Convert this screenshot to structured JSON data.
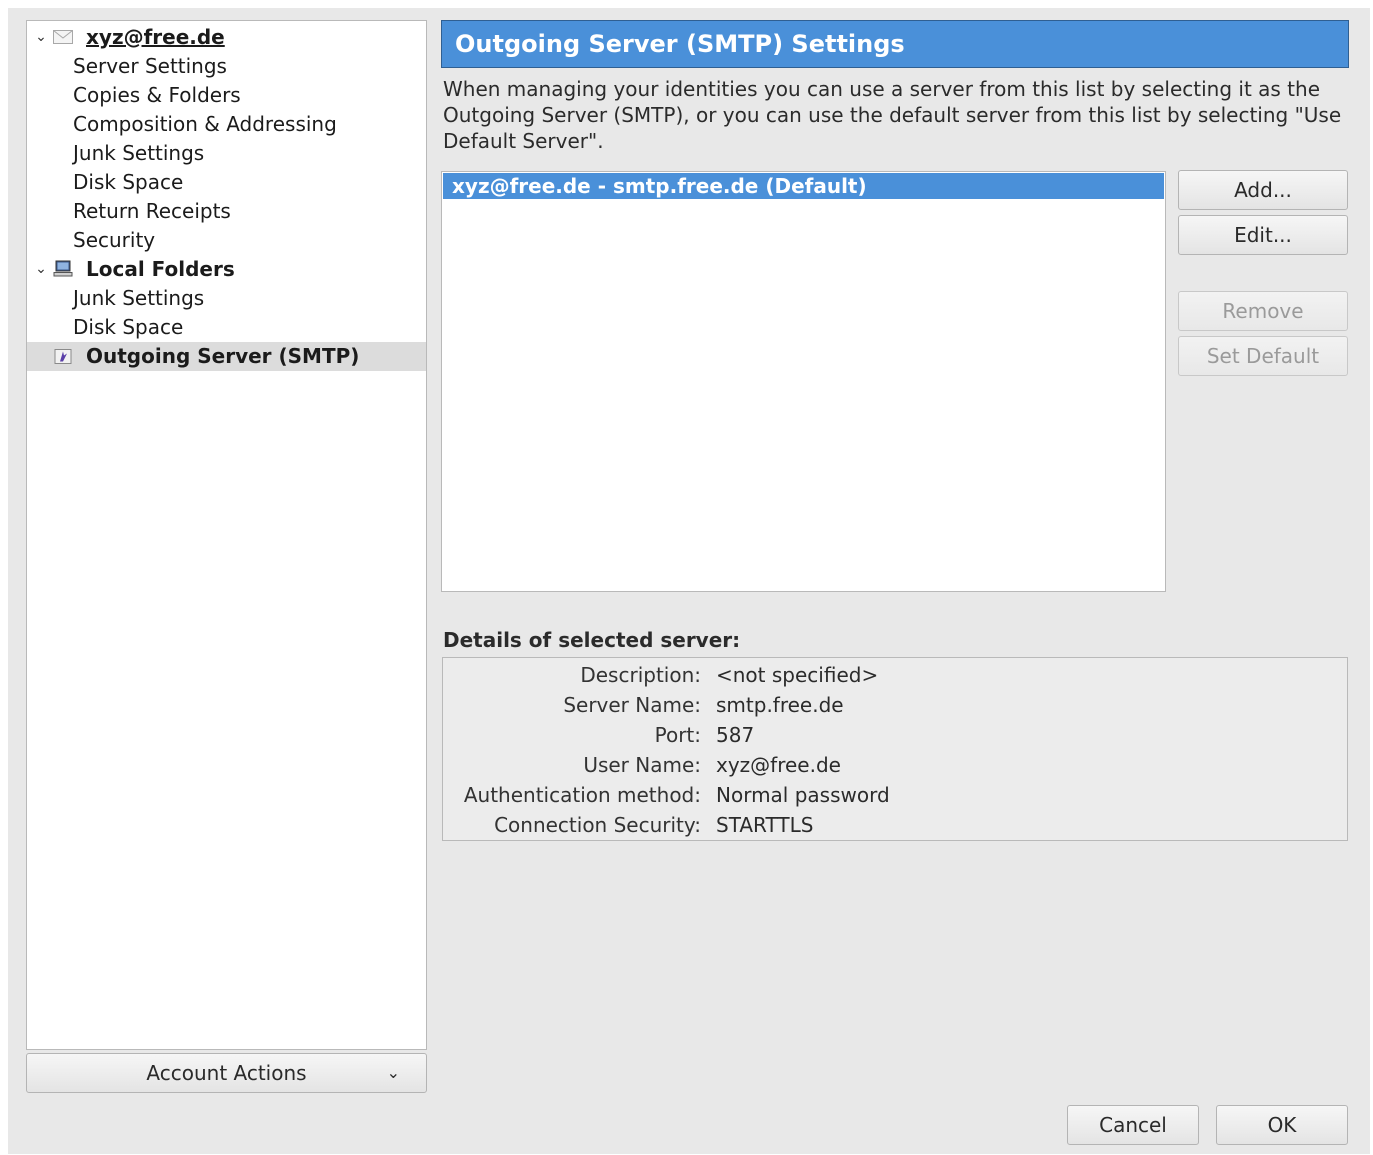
{
  "tree": {
    "account": {
      "label": "xyz@free.de",
      "children": [
        "Server Settings",
        "Copies & Folders",
        "Composition & Addressing",
        "Junk Settings",
        "Disk Space",
        "Return Receipts",
        "Security"
      ]
    },
    "local": {
      "label": "Local Folders",
      "children": [
        "Junk Settings",
        "Disk Space"
      ]
    },
    "smtp": {
      "label": "Outgoing Server (SMTP)"
    }
  },
  "account_actions": {
    "label": "Account Actions",
    "icon": "chevron-down-icon"
  },
  "pane": {
    "title": "Outgoing Server (SMTP) Settings",
    "description": "When managing your identities you can use a server from this list by selecting it as the Outgoing Server (SMTP), or you can use the default server from this list by selecting \"Use Default Server\".",
    "servers": [
      "xyz@free.de - smtp.free.de (Default)"
    ],
    "buttons": {
      "add": "Add...",
      "edit": "Edit...",
      "remove": "Remove",
      "set_default": "Set Default"
    },
    "details_title": "Details of selected server:",
    "details": [
      {
        "label": "Description:",
        "value": "<not specified>"
      },
      {
        "label": "Server Name:",
        "value": "smtp.free.de"
      },
      {
        "label": "Port:",
        "value": "587"
      },
      {
        "label": "User Name:",
        "value": "xyz@free.de"
      },
      {
        "label": "Authentication method:",
        "value": "Normal password"
      },
      {
        "label": "Connection Security:",
        "value": "STARTTLS"
      }
    ]
  },
  "dialog_buttons": {
    "cancel": "Cancel",
    "ok": "OK"
  },
  "colors": {
    "accent": "#4a90d9",
    "selection_row": "#dcdcdc",
    "background": "#e8e8e8"
  }
}
